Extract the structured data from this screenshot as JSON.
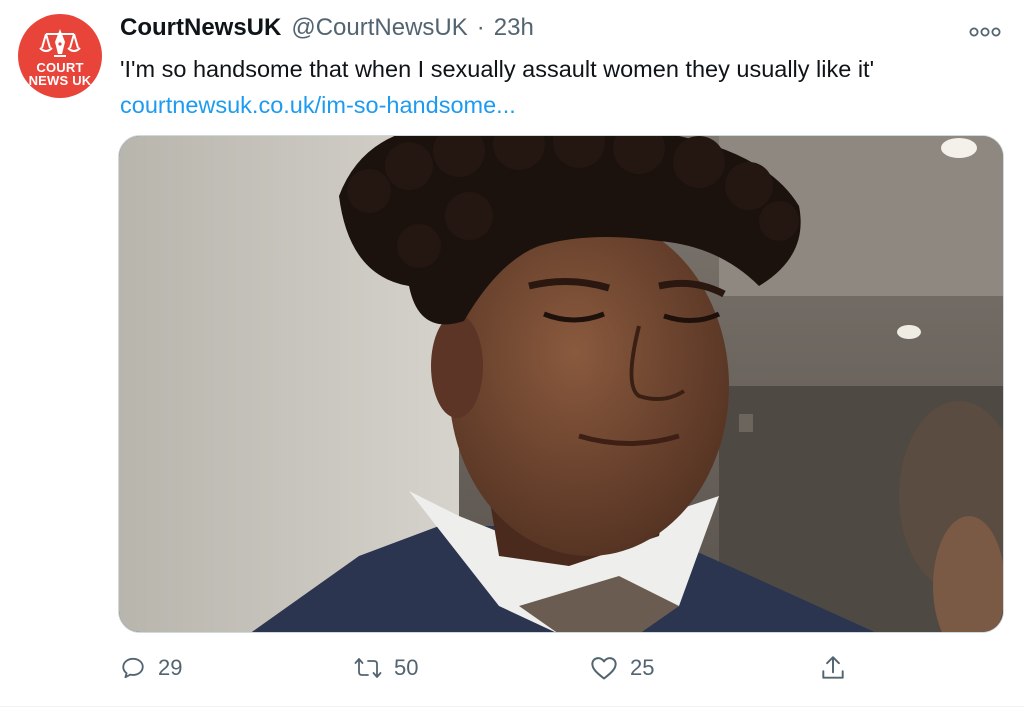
{
  "tweet": {
    "avatar": {
      "line1": "COURT",
      "line2": "NEWS UK",
      "color": "#e8443a"
    },
    "display_name": "CourtNewsUK",
    "handle": "@CourtNewsUK",
    "separator": "·",
    "time": "23h",
    "more_icon": "more-horizontal-icon",
    "text": "'I'm so handsome that when I sexually assault women they usually like it'",
    "link": "courtnewsuk.co.uk/im-so-handsome...",
    "media": {
      "description": "photo"
    },
    "actions": {
      "reply": {
        "icon": "reply-icon",
        "count": "29"
      },
      "retweet": {
        "icon": "retweet-icon",
        "count": "50"
      },
      "like": {
        "icon": "heart-icon",
        "count": "25"
      },
      "share": {
        "icon": "share-icon"
      }
    }
  },
  "colors": {
    "link": "#1d9bf0",
    "secondary_text": "#536471",
    "primary_text": "#0f1419"
  }
}
